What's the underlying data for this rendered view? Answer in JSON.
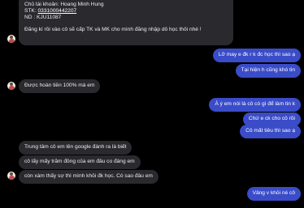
{
  "messages_in": {
    "account_holder": "Chủ tài khoản: Hoang Minh Hung",
    "account_number_label": "STK: ",
    "account_number": "0331000442207",
    "transfer_note": "ND : KJU11087",
    "register_msg": "Đăng kí rồi vào cô sẽ cấp TK và MK cho mình đăng nhập dô học thôi nhé !",
    "refund_msg": "Được hoàn tiền 100% mà em",
    "google_msg": "Trung tâm cô em lên google đánh ra là biết",
    "money_msg": "cô lấy mấy trăm đồng của em đâu co đáng em",
    "worry_msg": "còn xàm thấy sợ thì mình khỏi đk học. Có sao đâu em"
  },
  "messages_out": {
    "msg_1": "Lỡ may e đk r k đc học thì sao ạ",
    "msg_2": "Tại hiện h cũng khó tin",
    "msg_3": "À ý em nói là cô có gì để làm tin k",
    "msg_4": "Chứ e ck cho cô rồi",
    "msg_5": "Cô mất tiêu thì sao ạ",
    "msg_6": "Vâng v khỏi nè cô"
  },
  "colors": {
    "incoming_bubble": "#2a2a2e",
    "outgoing_bubble": "#3a4cc8",
    "background": "#000000"
  },
  "icons": {
    "sender_avatar": "avatar-icon"
  }
}
